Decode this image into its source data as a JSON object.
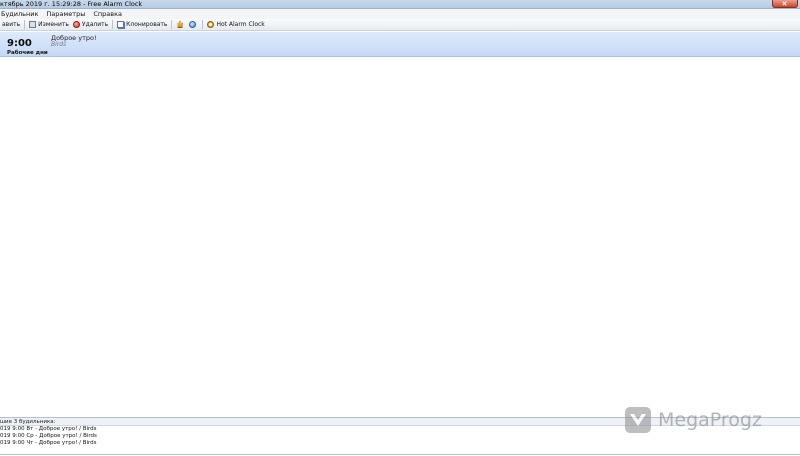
{
  "window": {
    "title": "ктябрь 2019 г. 15:29:28 - Free Alarm Clock"
  },
  "menu": {
    "items": [
      "Будильник",
      "Параметры",
      "Справка"
    ]
  },
  "toolbar": {
    "add_label": "авить",
    "edit_label": "Изменить",
    "delete_label": "Удалить",
    "clone_label": "Клонировать",
    "hot_alarm_label": "Hot Alarm Clock"
  },
  "alarms": [
    {
      "time": "9:00",
      "days": "Рабочие дни",
      "label": "Доброе утро!",
      "sound": "Birds"
    }
  ],
  "next_alarms": {
    "header": "шие 3 будильника:",
    "items": [
      "019 9:00 Вт - Доброе утро! / Birds",
      "019 9:00 Ср - Доброе утро! / Birds",
      "019 9:00 Чт - Доброе утро! / Birds"
    ]
  },
  "watermark": {
    "text": "MegaProgz"
  },
  "colors": {
    "selected_row": "#cfdff8",
    "titlebar": "#c1d3e9",
    "close_button": "#c9462c"
  }
}
